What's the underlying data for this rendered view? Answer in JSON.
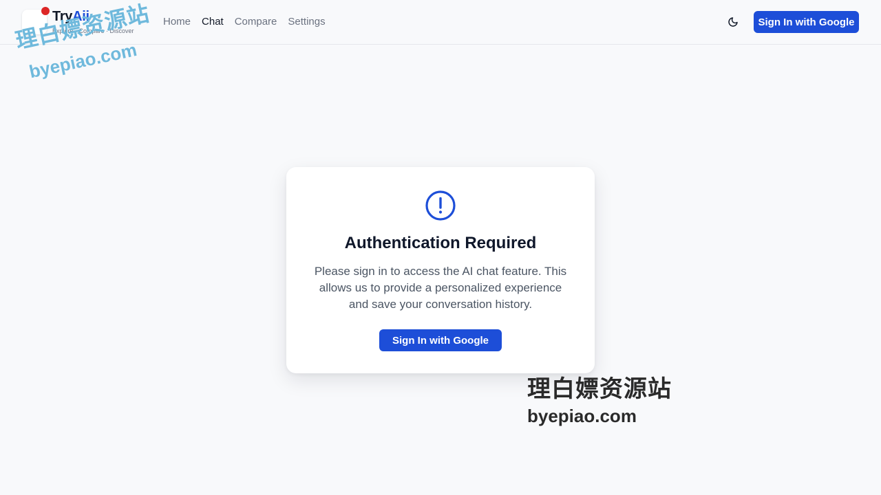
{
  "header": {
    "brand_prefix": "Try",
    "brand_accent": "Aii",
    "tagline": "Explore · Compare · Discover",
    "nav": [
      {
        "label": "Home",
        "active": false
      },
      {
        "label": "Chat",
        "active": true
      },
      {
        "label": "Compare",
        "active": false
      },
      {
        "label": "Settings",
        "active": false
      }
    ],
    "theme_icon": "moon-icon",
    "signin_label": "Sign In with Google"
  },
  "card": {
    "icon": "exclamation-circle-icon",
    "title": "Authentication Required",
    "message": "Please sign in to access the AI chat feature. This allows us to provide a personalized experience and save your conversation history.",
    "button_label": "Sign In with Google"
  },
  "watermarks": {
    "top_cn": "理白嫖资源站",
    "top_en": "byepiao.com",
    "bottom_cn": "理白嫖资源站",
    "bottom_en": "byepiao.com"
  },
  "colors": {
    "accent": "#1d4ed8",
    "logo_dot": "#dc2626",
    "background": "#f8f9fb"
  }
}
